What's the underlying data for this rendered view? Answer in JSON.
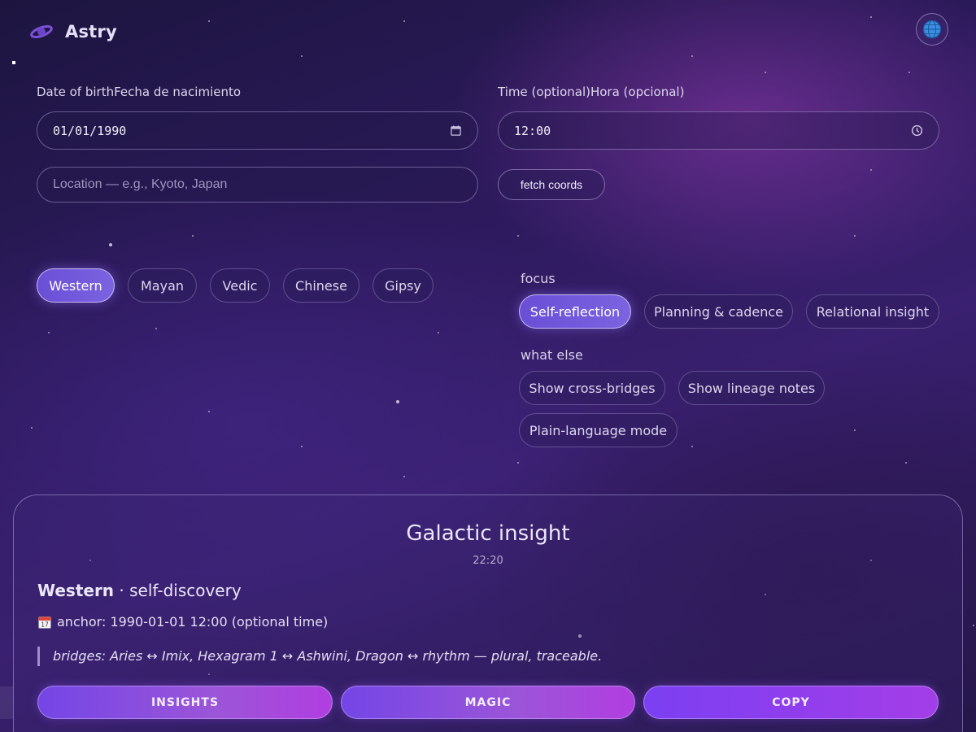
{
  "app": {
    "name": "Astry"
  },
  "header": {
    "language_icon": "globe-icon"
  },
  "form": {
    "dob_label": "Date of birthFecha de nacimiento",
    "dob_value": "01/01/1990",
    "time_label": "Time (optional)Hora (opcional)",
    "time_value": "12:00",
    "location_placeholder": "Location — e.g., Kyoto, Japan",
    "location_value": "",
    "fetch_label": "fetch coords"
  },
  "systems": [
    "Western",
    "Mayan",
    "Vedic",
    "Chinese",
    "Gipsy"
  ],
  "systems_active": "Western",
  "focus": {
    "label": "focus",
    "options": [
      "Self-reflection",
      "Planning & cadence",
      "Relational insight"
    ],
    "active": "Self-reflection"
  },
  "extras": {
    "label": "what else",
    "options": [
      "Show cross-bridges",
      "Show lineage notes",
      "Plain-language mode"
    ]
  },
  "result": {
    "title": "Galactic insight",
    "time": "22:20",
    "system": "Western",
    "theme": " · self-discovery",
    "anchor_icon": "calendar-icon",
    "anchor": "anchor: 1990-01-01 12:00 (optional time)",
    "bridges": "bridges: Aries ↔ Imix, Hexagram 1 ↔ Ashwini, Dragon ↔ rhythm — plural, traceable."
  },
  "actions": {
    "insights": "INSIGHTS",
    "magic": "MAGIC",
    "copy": "COPY"
  },
  "colors": {
    "accent": "#6a4fd6",
    "button_start": "#7b3ff2",
    "button_end": "#a33ee8"
  }
}
